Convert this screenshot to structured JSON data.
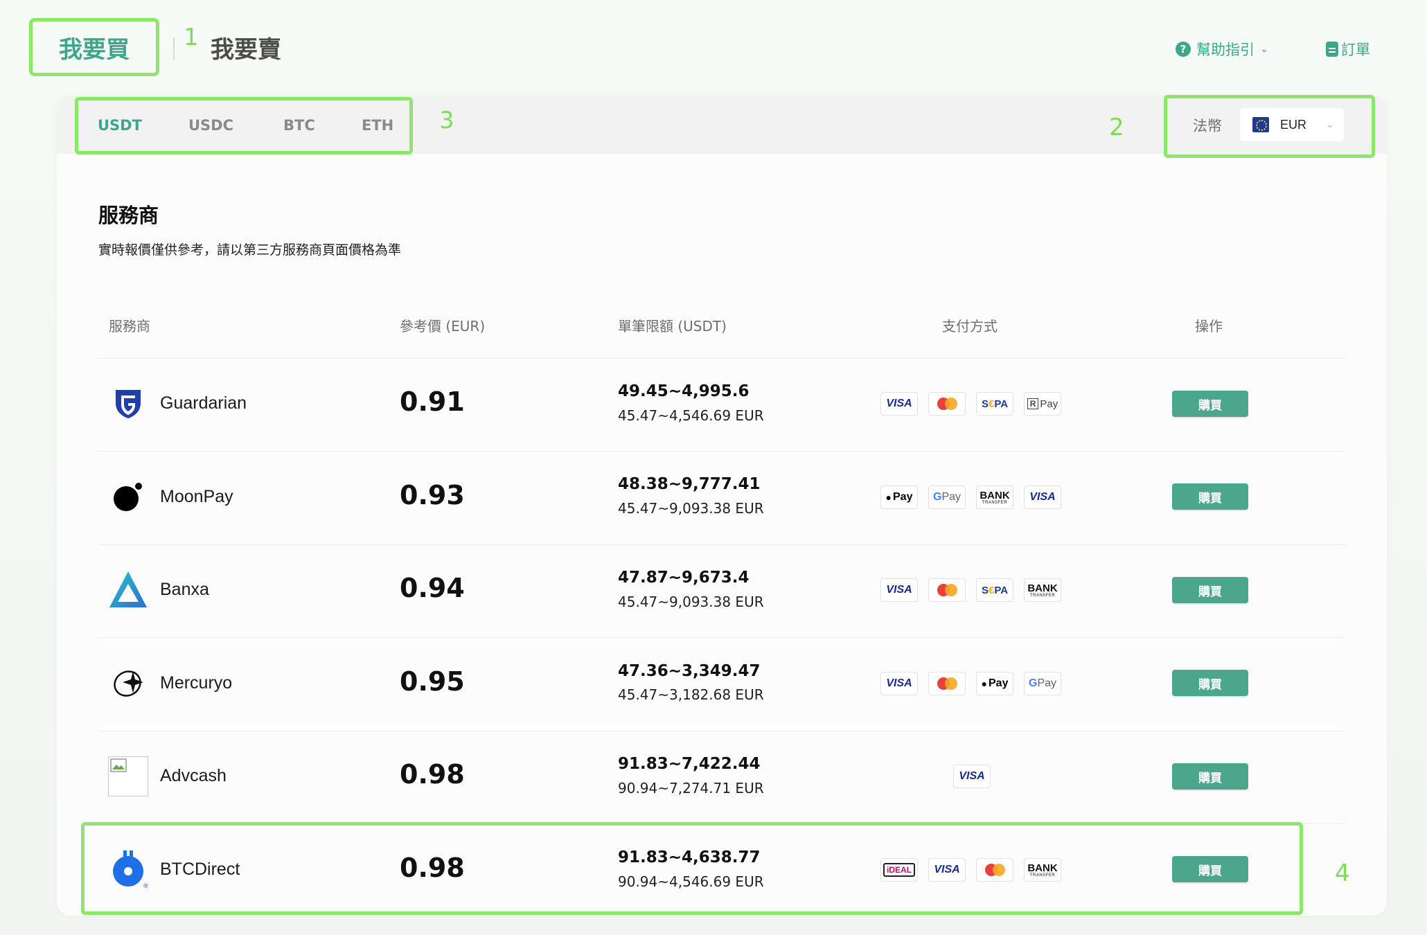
{
  "header": {
    "tab_buy": "我要買",
    "tab_sell": "我要賣",
    "help": "幫助指引",
    "orders": "訂單"
  },
  "annotations": [
    "1",
    "2",
    "3",
    "4"
  ],
  "coins": [
    "USDT",
    "USDC",
    "BTC",
    "ETH"
  ],
  "fiat": {
    "label": "法幣",
    "code": "EUR"
  },
  "section": {
    "title": "服務商",
    "subtitle": "實時報價僅供參考，請以第三方服務商頁面價格為準"
  },
  "table": {
    "headers": [
      "服務商",
      "參考價 (EUR)",
      "單筆限額 (USDT)",
      "支付方式",
      "操作"
    ],
    "buy_label": "購買",
    "rows": [
      {
        "name": "Guardarian",
        "price": "0.91",
        "limit_usdt": "49.45~4,995.6",
        "limit_eur": "45.47~4,546.69 EUR",
        "payments": [
          "visa",
          "mastercard",
          "sepa",
          "revolut-pay"
        ]
      },
      {
        "name": "MoonPay",
        "price": "0.93",
        "limit_usdt": "48.38~9,777.41",
        "limit_eur": "45.47~9,093.38 EUR",
        "payments": [
          "apple-pay",
          "google-pay",
          "bank-transfer",
          "visa"
        ]
      },
      {
        "name": "Banxa",
        "price": "0.94",
        "limit_usdt": "47.87~9,673.4",
        "limit_eur": "45.47~9,093.38 EUR",
        "payments": [
          "visa",
          "mastercard",
          "sepa",
          "bank-transfer"
        ]
      },
      {
        "name": "Mercuryo",
        "price": "0.95",
        "limit_usdt": "47.36~3,349.47",
        "limit_eur": "45.47~3,182.68 EUR",
        "payments": [
          "visa",
          "mastercard",
          "apple-pay",
          "google-pay"
        ]
      },
      {
        "name": "Advcash",
        "price": "0.98",
        "limit_usdt": "91.83~7,422.44",
        "limit_eur": "90.94~7,274.71 EUR",
        "payments": [
          "visa"
        ]
      },
      {
        "name": "BTCDirect",
        "price": "0.98",
        "limit_usdt": "91.83~4,638.77",
        "limit_eur": "90.94~4,546.69 EUR",
        "payments": [
          "ideal",
          "visa",
          "mastercard",
          "bank-transfer"
        ]
      }
    ]
  },
  "payment_text": {
    "visa": "VISA",
    "sepa_s": "S",
    "sepa_e": "€",
    "sepa_pa": "PA",
    "rpay": "Pay",
    "apay": "Pay",
    "gpay_g": "G",
    "gpay": " Pay",
    "bank1": "BANK",
    "bank2": "TRANSFER",
    "ideal": "iDEAL"
  },
  "colors": {
    "accent": "#3ea68a",
    "button": "#4ba68c",
    "annotation": "#8ee66a"
  }
}
